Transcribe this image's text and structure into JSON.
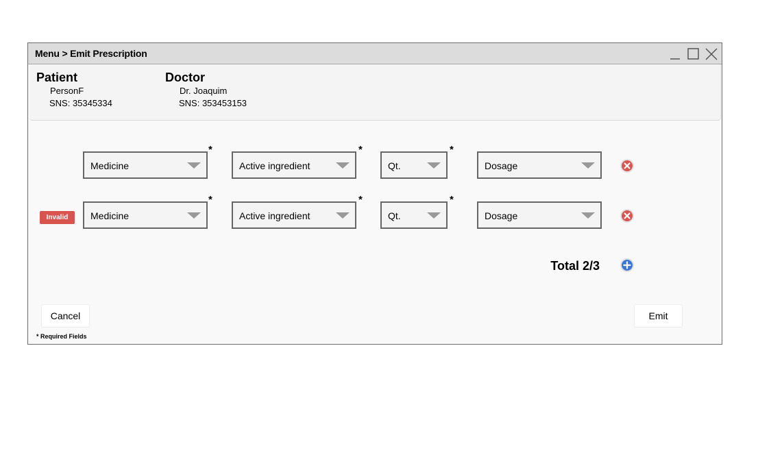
{
  "window": {
    "title": "Menu > Emit Prescription"
  },
  "patient": {
    "heading": "Patient",
    "name": "PersonF",
    "sns": "SNS: 35345334"
  },
  "doctor": {
    "heading": "Doctor",
    "name": "Dr. Joaquim",
    "sns": "SNS: 353453153"
  },
  "rows": [
    {
      "invalid": false,
      "medicine": "Medicine",
      "active_ingredient": "Active ingredient",
      "quantity": "Qt.",
      "dosage": "Dosage"
    },
    {
      "invalid": true,
      "invalid_label": "Invalid",
      "medicine": "Medicine",
      "active_ingredient": "Active ingredient",
      "quantity": "Qt.",
      "dosage": "Dosage"
    }
  ],
  "required_marker": "*",
  "total": "Total 2/3",
  "buttons": {
    "cancel": "Cancel",
    "emit": "Emit"
  },
  "required_note": "* Required Fields",
  "icons": {
    "minimize": "minimize-icon",
    "maximize": "maximize-icon",
    "close": "close-icon",
    "remove_row": "remove-circle-icon",
    "add_row": "add-circle-icon"
  },
  "colors": {
    "invalid_badge": "#d9534f",
    "remove_icon": "#d9534f",
    "add_icon": "#3a78d4"
  }
}
